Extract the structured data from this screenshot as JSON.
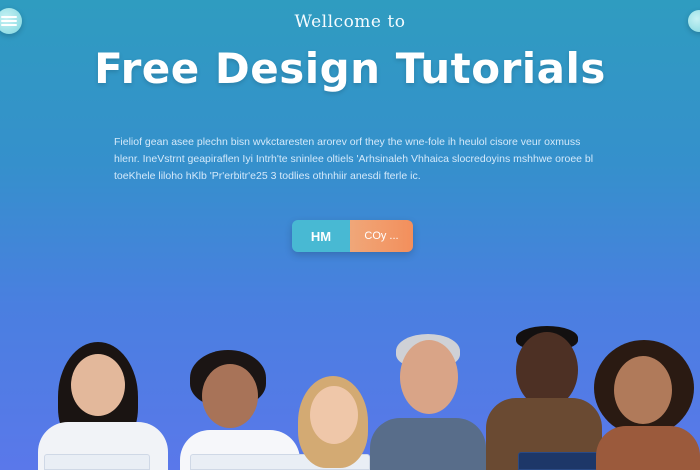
{
  "header": {
    "kicker": "Wellcome to",
    "title": "Free Design Tutorials"
  },
  "intro": {
    "lines": [
      "Fieliof gean asee plechn bisn wvkctaresten arorev orf they the wne-fole ih heulol cisore veur oxmuss",
      "hlenr. IneVstrnt geapiraflen Iyi Intrh'te sninlee oltiels 'Arhsinaleh Vhhaica slocredoyins mshhwe oroee bl",
      "toeKhele liloho hKlb 'Pr'erbitr'e25 3 todlies othnhiir anesdi fterle ic."
    ]
  },
  "cta": {
    "primary_label": "HM",
    "secondary_label": "COy ..."
  },
  "icons": {
    "left_corner": "menu-icon",
    "right_corner": "circle-icon"
  },
  "colors": {
    "bg_top": "#2f9cc0",
    "bg_bottom": "#5a78ea",
    "primary_button": "#48b9d3",
    "secondary_button": "#f38f5c"
  }
}
